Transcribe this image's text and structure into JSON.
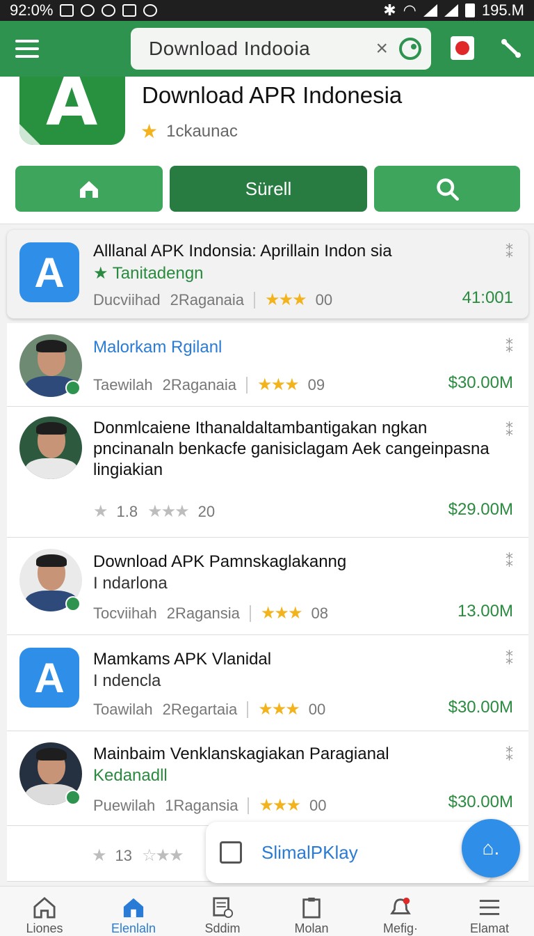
{
  "status_bar": {
    "left_text": "92:0%",
    "right_text": "195.M"
  },
  "appbar": {
    "search_value": "Download Indooia",
    "clear_symbol": "×"
  },
  "header": {
    "title": "Download APR Indonesia",
    "subtitle": "1ckaunac",
    "buttons": [
      {
        "label": "",
        "icon": "home-icon"
      },
      {
        "label": "Sürell"
      },
      {
        "label": "",
        "icon": "search-icon"
      }
    ]
  },
  "list": [
    {
      "title": "Alllanal APK Indonsia: Aprillain Indon sia",
      "subline": "★ Tanitadengn",
      "meta_left": "Ducviihad",
      "meta_mid": "2Raganaia",
      "rating": "00",
      "price": "41:001"
    },
    {
      "title": "Malorkam Rgilanl",
      "meta_left": "Taewilah",
      "meta_mid": "2Raganaia",
      "rating": "09",
      "price": "$30.00M"
    },
    {
      "title": "Donmlcaiene Ithanaldaltambantigakan ngkan pncinanaln benkacfe ganisiclagam Aek cangeinpasna lingiakian",
      "meta_left": "1.8",
      "rating": "20",
      "price": "$29.00M"
    },
    {
      "title": "Download APK Pamnskaglakanng",
      "subline": "I ndarlona",
      "meta_left": "Tocviihah",
      "meta_mid": "2Ragansia",
      "rating": "08",
      "price": "13.00M"
    },
    {
      "title": "Mamkams APK Vlanidal",
      "subline": "I ndencla",
      "meta_left": "Toawilah",
      "meta_mid": "2Regartaia",
      "rating": "00",
      "price": "$30.00M"
    },
    {
      "title": "Mainbaim Venklanskagiakan Paragianal",
      "subline": "Kedanadll",
      "meta_left": "Puewilah",
      "meta_mid": "1Ragansia",
      "rating": "00",
      "price": "$30.00M"
    }
  ],
  "partial_row": {
    "meta_left": "13"
  },
  "floating": {
    "label": "SlimalPKlay",
    "fab_label": "⌂."
  },
  "bottom_nav": [
    {
      "label": "Liones",
      "icon": "home-outline-icon"
    },
    {
      "label": "Elenlaln",
      "icon": "home-filled-icon"
    },
    {
      "label": "Sddim",
      "icon": "add-document-icon"
    },
    {
      "label": "Molan",
      "icon": "clipboard-icon"
    },
    {
      "label": "Mefig·",
      "icon": "bell-icon"
    },
    {
      "label": "Elamat",
      "icon": "menu-icon"
    }
  ],
  "colors": {
    "primary_green": "#2f9350",
    "accent_blue": "#2a7bd6",
    "star_yellow": "#f2b31d"
  }
}
